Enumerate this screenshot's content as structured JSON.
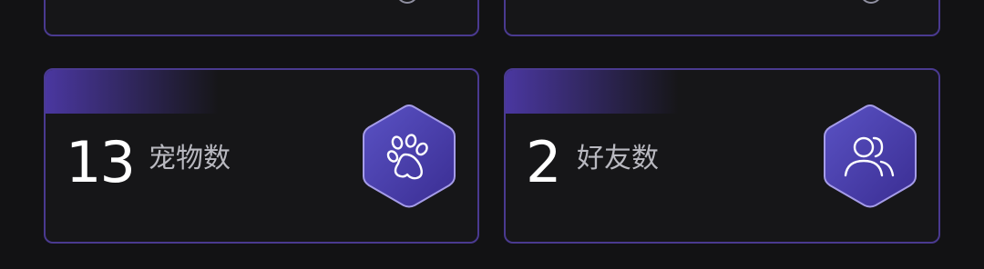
{
  "stats": [
    {
      "value": "13",
      "label": "宠物数",
      "icon": "paw-icon"
    },
    {
      "value": "2",
      "label": "好友数",
      "icon": "users-icon"
    }
  ],
  "colors": {
    "background": "#121214",
    "card_border": "#4a3a90",
    "card_background": "#161618",
    "accent": "#4a37a0",
    "value_text": "#ffffff",
    "label_text": "#b9b9c0"
  }
}
